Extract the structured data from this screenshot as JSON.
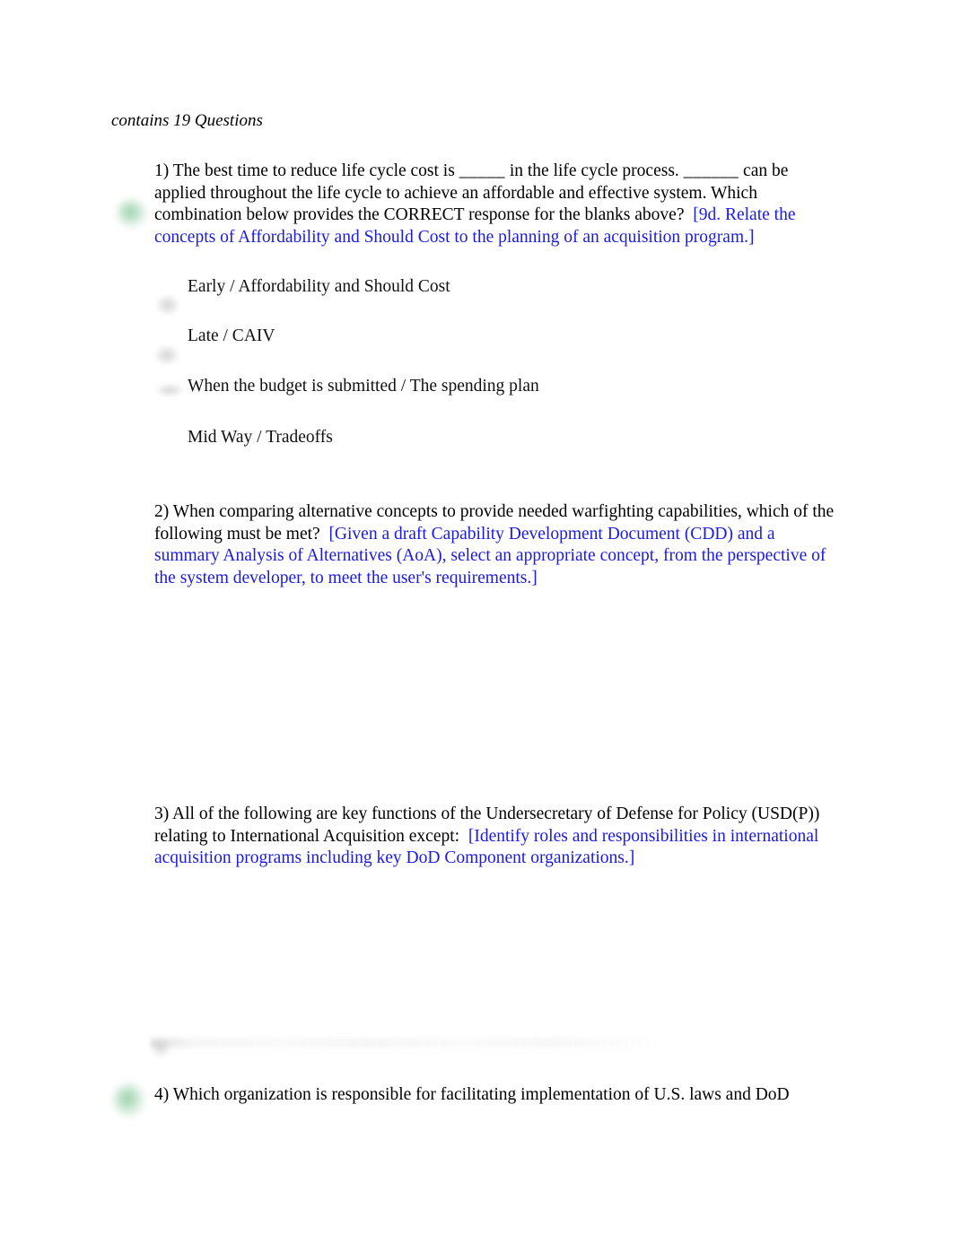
{
  "document": {
    "header": "contains 19 Questions",
    "page_background": "#ffffff",
    "body_text_color": "#000000",
    "objective_text_color": "#1a1ae6",
    "highlight_blob_color": "#56b070"
  },
  "questions": [
    {
      "number": "1)",
      "stem_part_1": "1) The best time to reduce life cycle cost is ",
      "blank_1": "_____",
      "stem_part_2": " in the life cycle process. ",
      "blank_2": "______",
      "stem_part_3": " can be applied throughout the life cycle to achieve an affordable and effective system. Which combination below provides the CORRECT response for the blanks above?  ",
      "objective": "[9d. Relate the concepts of Affordability and Should Cost to the planning of an acquisition program.]",
      "options": [
        "Early / Affordability and Should Cost",
        "Late / CAIV",
        "When the budget is submitted / The spending plan",
        "Mid Way / Tradeoffs"
      ]
    },
    {
      "number": "2)",
      "stem": "2) When comparing alternative concepts to provide needed warfighting capabilities, which of the following must be met?  ",
      "objective": "[Given a draft Capability Development Document (CDD) and a summary Analysis of Alternatives (AoA), select an appropriate concept, from the perspective of the system developer, to meet the user's requirements.]",
      "options": []
    },
    {
      "number": "3)",
      "stem": "3) All of the following are key functions of the Undersecretary of Defense for Policy (USD(P)) relating to International Acquisition except:  ",
      "objective": "[Identify roles and responsibilities in international acquisition programs including key DoD Component organizations.]",
      "options": []
    },
    {
      "number": "4)",
      "stem": "4) Which organization is responsible for facilitating implementation of U.S. laws and DoD",
      "objective": "",
      "options": []
    }
  ]
}
